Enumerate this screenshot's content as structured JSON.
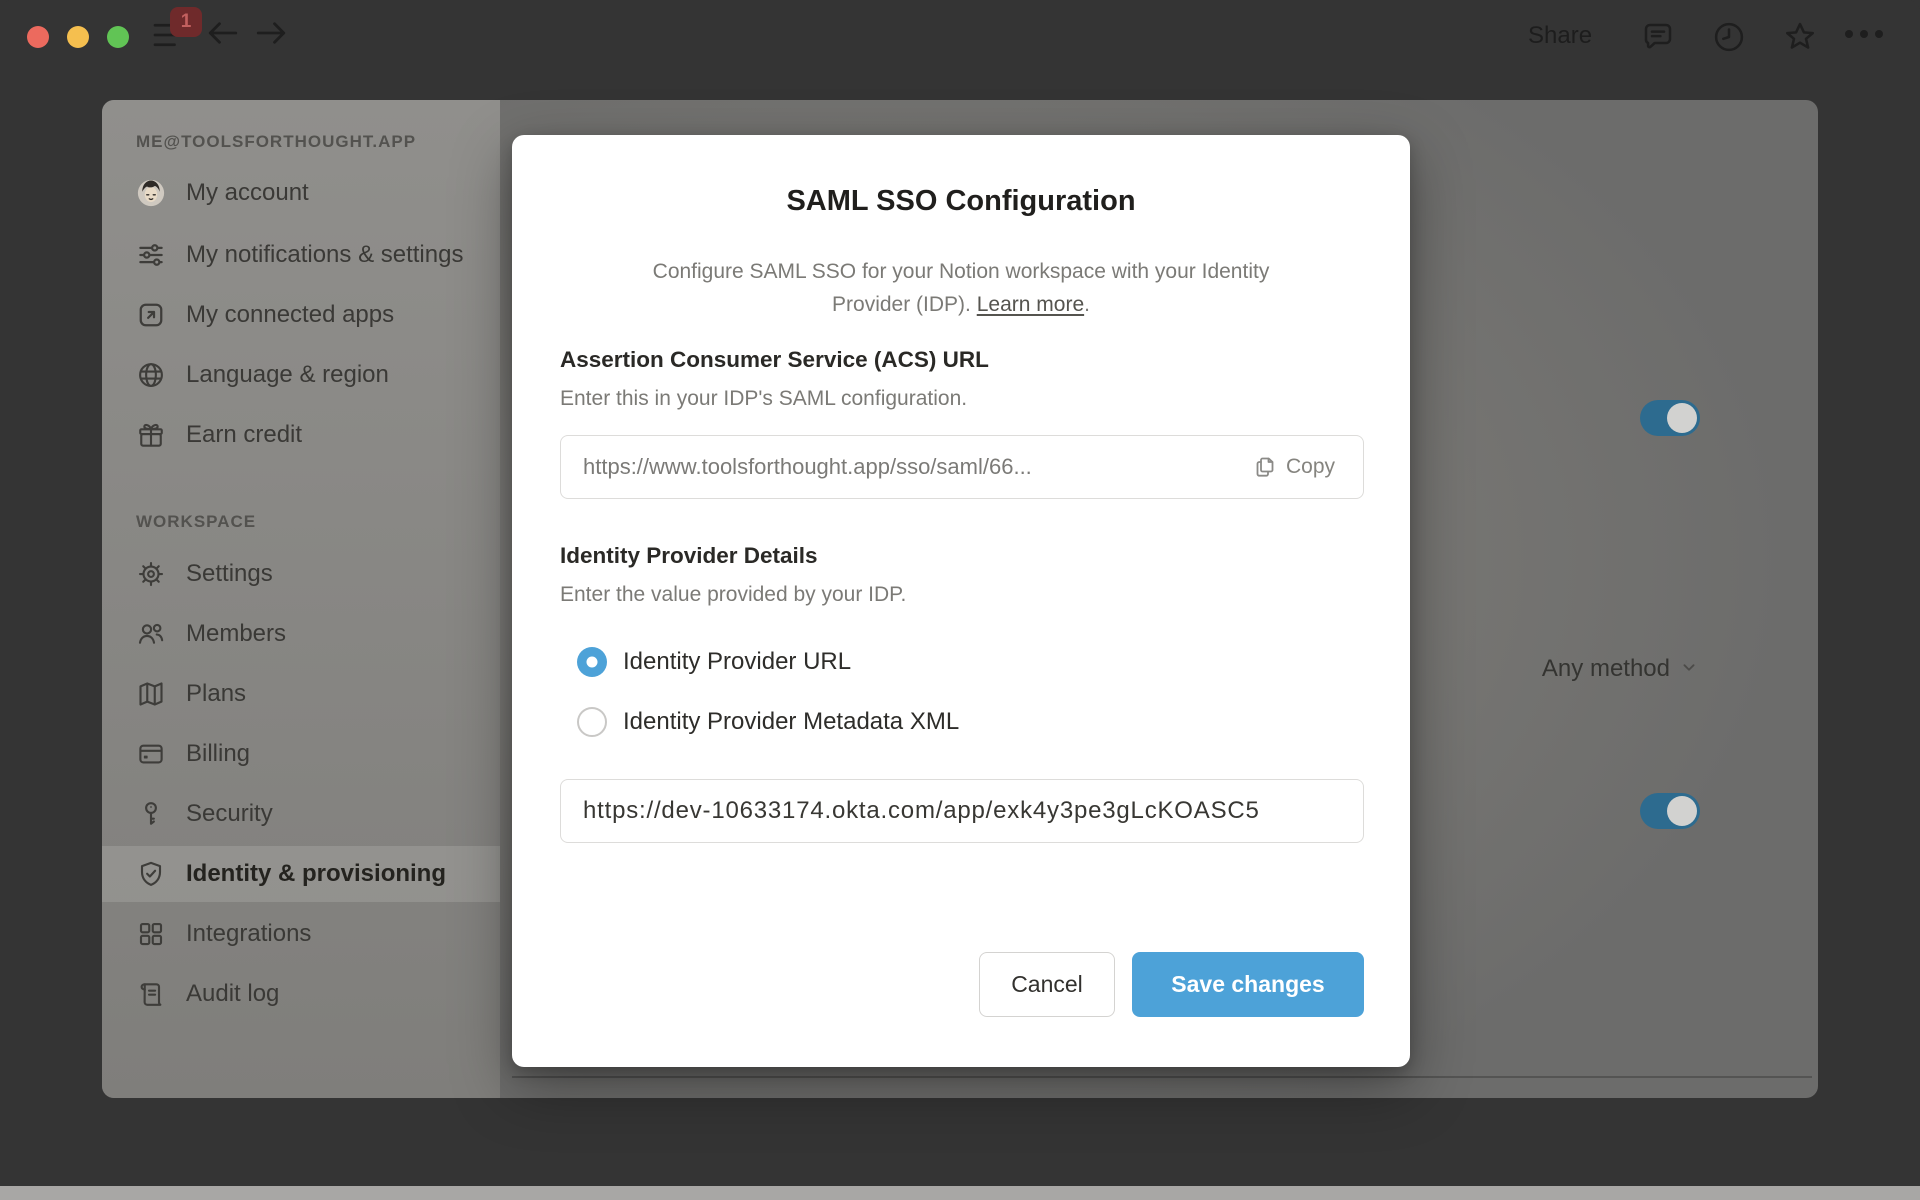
{
  "titlebar": {
    "share_label": "Share",
    "badge_count": "1"
  },
  "sidebar": {
    "account_header": "ME@TOOLSFORTHOUGHT.APP",
    "items": [
      {
        "label": "My account",
        "icon": "avatar"
      },
      {
        "label": "My notifications & settings",
        "icon": "sliders-icon"
      },
      {
        "label": "My connected apps",
        "icon": "arrow-up-right-square-icon"
      },
      {
        "label": "Language & region",
        "icon": "globe-icon"
      },
      {
        "label": "Earn credit",
        "icon": "gift-icon"
      }
    ],
    "workspace_header": "WORKSPACE",
    "workspace_items": [
      {
        "label": "Settings",
        "icon": "gear-icon"
      },
      {
        "label": "Members",
        "icon": "people-icon"
      },
      {
        "label": "Plans",
        "icon": "map-icon"
      },
      {
        "label": "Billing",
        "icon": "credit-card-icon"
      },
      {
        "label": "Security",
        "icon": "key-icon"
      },
      {
        "label": "Identity & provisioning",
        "icon": "shield-check-icon",
        "selected": true
      },
      {
        "label": "Integrations",
        "icon": "grid-icon"
      },
      {
        "label": "Audit log",
        "icon": "scroll-icon"
      }
    ]
  },
  "content": {
    "auth_method_value": "Any method",
    "toggle_top_state": "on",
    "toggle_bottom_state": "on"
  },
  "modal": {
    "title": "SAML SSO Configuration",
    "subtitle": "Configure SAML SSO for your Notion workspace with your Identity Provider (IDP).",
    "learn_more": "Learn more",
    "learn_more_suffix": ".",
    "acs": {
      "heading": "Assertion Consumer Service (ACS) URL",
      "description": "Enter this in your IDP's SAML configuration.",
      "value": "https://www.toolsforthought.app/sso/saml/66...",
      "copy_label": "Copy"
    },
    "idp": {
      "heading": "Identity Provider Details",
      "description": "Enter the value provided by your IDP.",
      "option_url": "Identity Provider URL",
      "option_xml": "Identity Provider Metadata XML",
      "url_value": "https://dev-10633174.okta.com/app/exk4y3pe3gLcKOASC5"
    },
    "cancel_label": "Cancel",
    "save_label": "Save changes"
  },
  "colors": {
    "accent_blue": "#4da2d8",
    "toggle_on_dimmed": "#2d6b8f",
    "traffic_red": "#ec6a5e",
    "traffic_yellow": "#f5bf4f",
    "traffic_green": "#61c455",
    "badge_red": "#6f2a2b",
    "modal_bg": "#ffffff",
    "window_chrome": "#343434"
  }
}
